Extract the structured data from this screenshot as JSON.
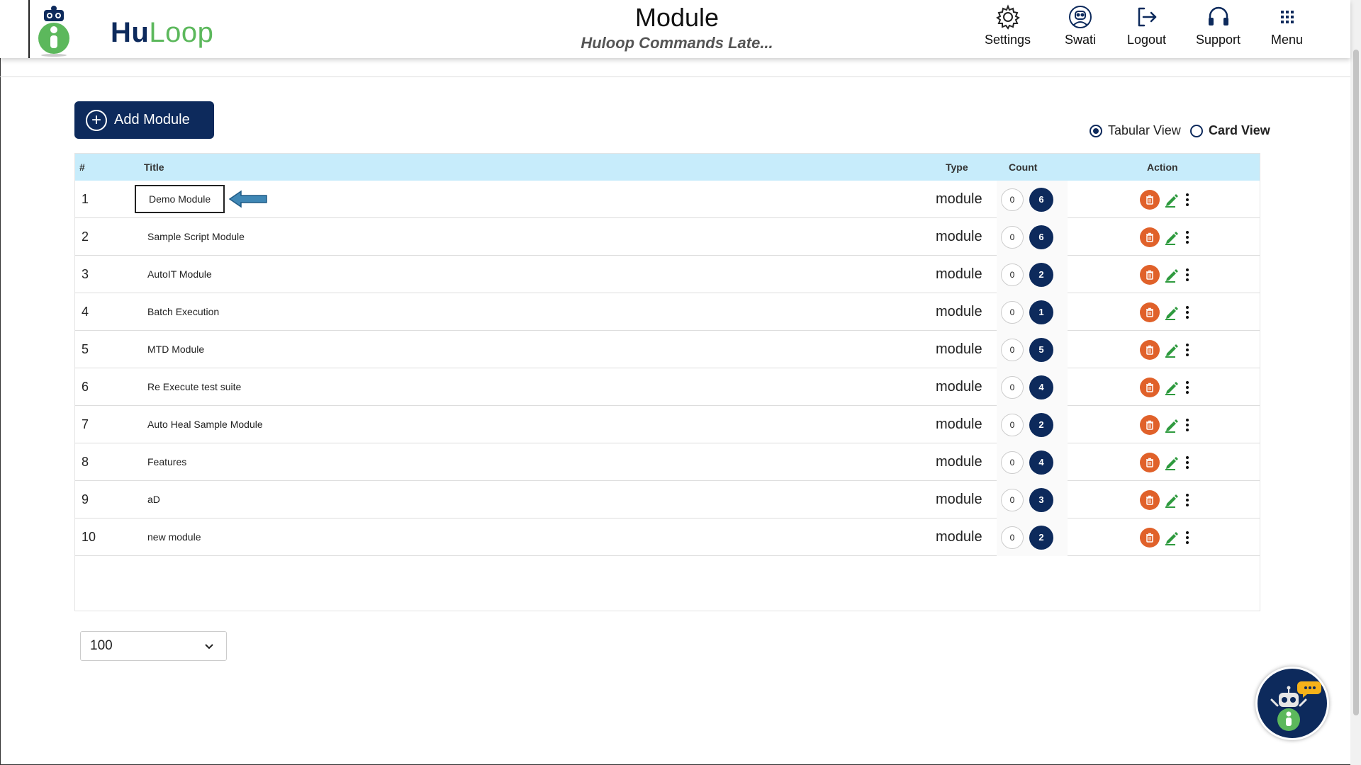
{
  "header": {
    "logo": {
      "hu": "Hu",
      "loop": "Loop"
    },
    "title": "Module",
    "subtitle": "Huloop Commands Late...",
    "nav": [
      {
        "label": "Settings",
        "icon": "gear-icon"
      },
      {
        "label": "Swati",
        "icon": "user-icon"
      },
      {
        "label": "Logout",
        "icon": "logout-icon"
      },
      {
        "label": "Support",
        "icon": "headset-icon"
      },
      {
        "label": "Menu",
        "icon": "grid-icon"
      }
    ]
  },
  "toolbar": {
    "add_label": "Add Module",
    "views": [
      {
        "label": "Tabular View",
        "selected": true
      },
      {
        "label": "Card View",
        "selected": false
      }
    ]
  },
  "table": {
    "columns": {
      "num": "#",
      "title": "Title",
      "type": "Type",
      "count": "Count",
      "action": "Action"
    },
    "rows": [
      {
        "num": "1",
        "title": "Demo Module",
        "type": "module",
        "count_a": "0",
        "count_b": "6"
      },
      {
        "num": "2",
        "title": "Sample Script Module",
        "type": "module",
        "count_a": "0",
        "count_b": "6"
      },
      {
        "num": "3",
        "title": "AutoIT Module",
        "type": "module",
        "count_a": "0",
        "count_b": "2"
      },
      {
        "num": "4",
        "title": "Batch Execution",
        "type": "module",
        "count_a": "0",
        "count_b": "1"
      },
      {
        "num": "5",
        "title": "MTD Module",
        "type": "module",
        "count_a": "0",
        "count_b": "5"
      },
      {
        "num": "6",
        "title": "Re Execute test suite",
        "type": "module",
        "count_a": "0",
        "count_b": "4"
      },
      {
        "num": "7",
        "title": "Auto Heal Sample Module",
        "type": "module",
        "count_a": "0",
        "count_b": "2"
      },
      {
        "num": "8",
        "title": "Features",
        "type": "module",
        "count_a": "0",
        "count_b": "4"
      },
      {
        "num": "9",
        "title": "aD",
        "type": "module",
        "count_a": "0",
        "count_b": "3"
      },
      {
        "num": "10",
        "title": "new module",
        "type": "module",
        "count_a": "0",
        "count_b": "2"
      }
    ]
  },
  "pagination": {
    "page_size": "100"
  },
  "colors": {
    "primary": "#0d2a5c",
    "accent_green": "#5cb85c",
    "delete": "#e0612a",
    "table_header": "#c7ecfb"
  }
}
